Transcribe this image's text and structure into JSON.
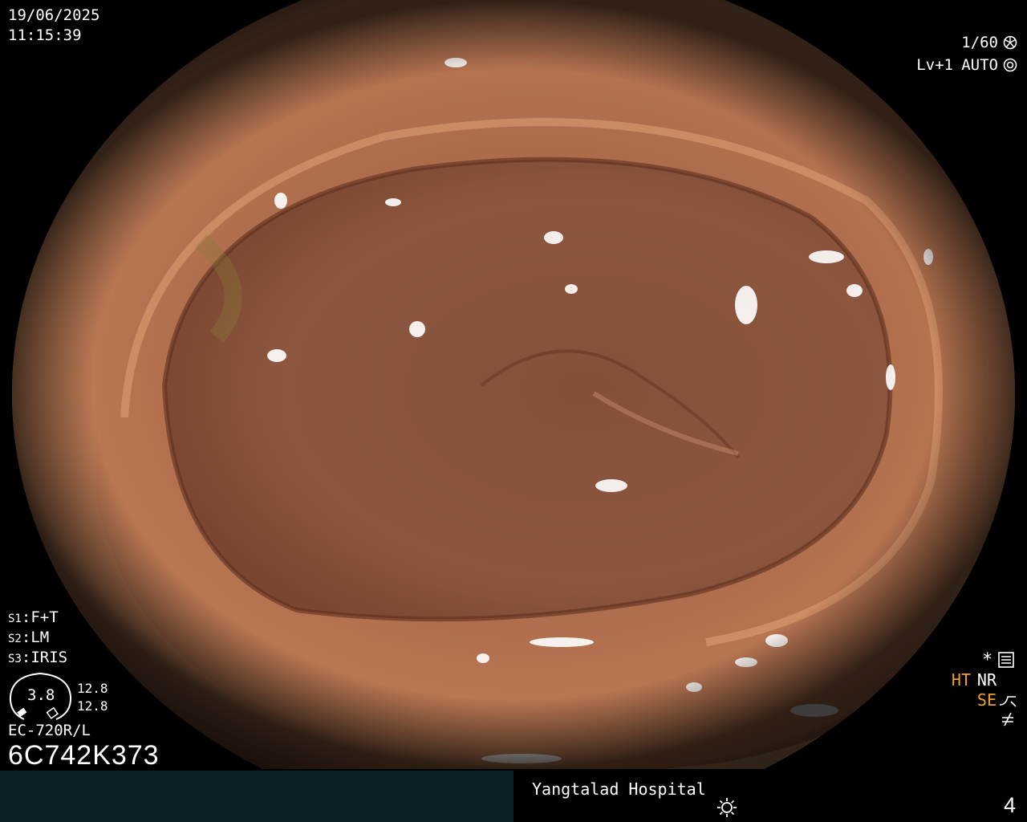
{
  "overlay": {
    "date": "19/06/2025",
    "time": "11:15:39",
    "shutter": "1/60",
    "enhance_level": "Lv+1",
    "iris_mode": "AUTO"
  },
  "settings": [
    {
      "key": "S1",
      "value": "F+T"
    },
    {
      "key": "S2",
      "value": "LM"
    },
    {
      "key": "S3",
      "value": "IRIS"
    }
  ],
  "gauge": {
    "value": "3.8",
    "upper": "12.8",
    "lower": "12.8"
  },
  "scope": {
    "model": "EC-720R/L",
    "serial": "6C742K373"
  },
  "modes": {
    "ht": "HT",
    "nr": "NR",
    "se": "SE"
  },
  "footer": {
    "hospital": "Yangtalad Hospital",
    "page": "4",
    "footer_left_color": "#0b2026"
  },
  "icons": [
    "shutter-icon",
    "iris-icon",
    "menu-icon",
    "se-curve-icon",
    "not-equal-icon",
    "sun-icon"
  ]
}
